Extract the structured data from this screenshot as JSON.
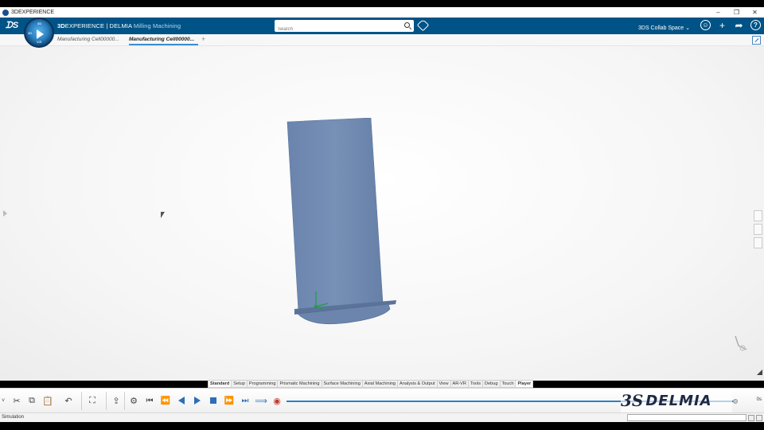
{
  "window": {
    "title": "3DEXPERIENCE",
    "controls": [
      "–",
      "❐",
      "✕"
    ]
  },
  "topbar": {
    "brand": "3D",
    "brand_rest": "EXPERIENCE | DELMIA",
    "app_name": "Milling Machining",
    "search_placeholder": "Search",
    "collab_space": "3DS Collab Space",
    "compass_labels": {
      "top": "3D",
      "left": "3D",
      "right": "V.R"
    }
  },
  "tabs": [
    {
      "label": "Manufacturing Cell00000...",
      "active": false
    },
    {
      "label": "Manufacturing Cell00000...",
      "active": true
    }
  ],
  "workbench_tabs": [
    "Standard",
    "Setup",
    "Programming",
    "Prismatic Machining",
    "Surface Machining",
    "Axial Machining",
    "Analysis & Output",
    "View",
    "AR-VR",
    "Tools",
    "Debug",
    "Touch",
    "Player"
  ],
  "active_workbench_tabs": [
    "Standard",
    "Player"
  ],
  "player": {
    "time": "0s"
  },
  "brand_logo": {
    "mark": "3S",
    "word": "DELMIA"
  },
  "status": {
    "text": "Simulation"
  },
  "colors": {
    "topbar": "#005386",
    "blade": "#6e87ac",
    "timeline": "#2c7fc4"
  }
}
